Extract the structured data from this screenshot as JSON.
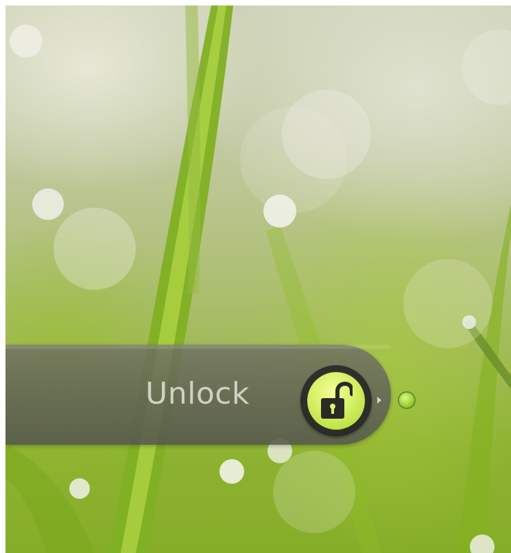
{
  "lockscreen": {
    "slider": {
      "label": "Unlock",
      "handle_icon": "unlock-padlock-icon",
      "arrow_icon": "chevron-right-icon",
      "target_icon": "target-dot-icon"
    }
  },
  "colors": {
    "handle_accent": "#d9f26a",
    "handle_ring": "#2b2c28",
    "slider_bar": "#5f6056",
    "target_dot": "#9fd43a"
  }
}
